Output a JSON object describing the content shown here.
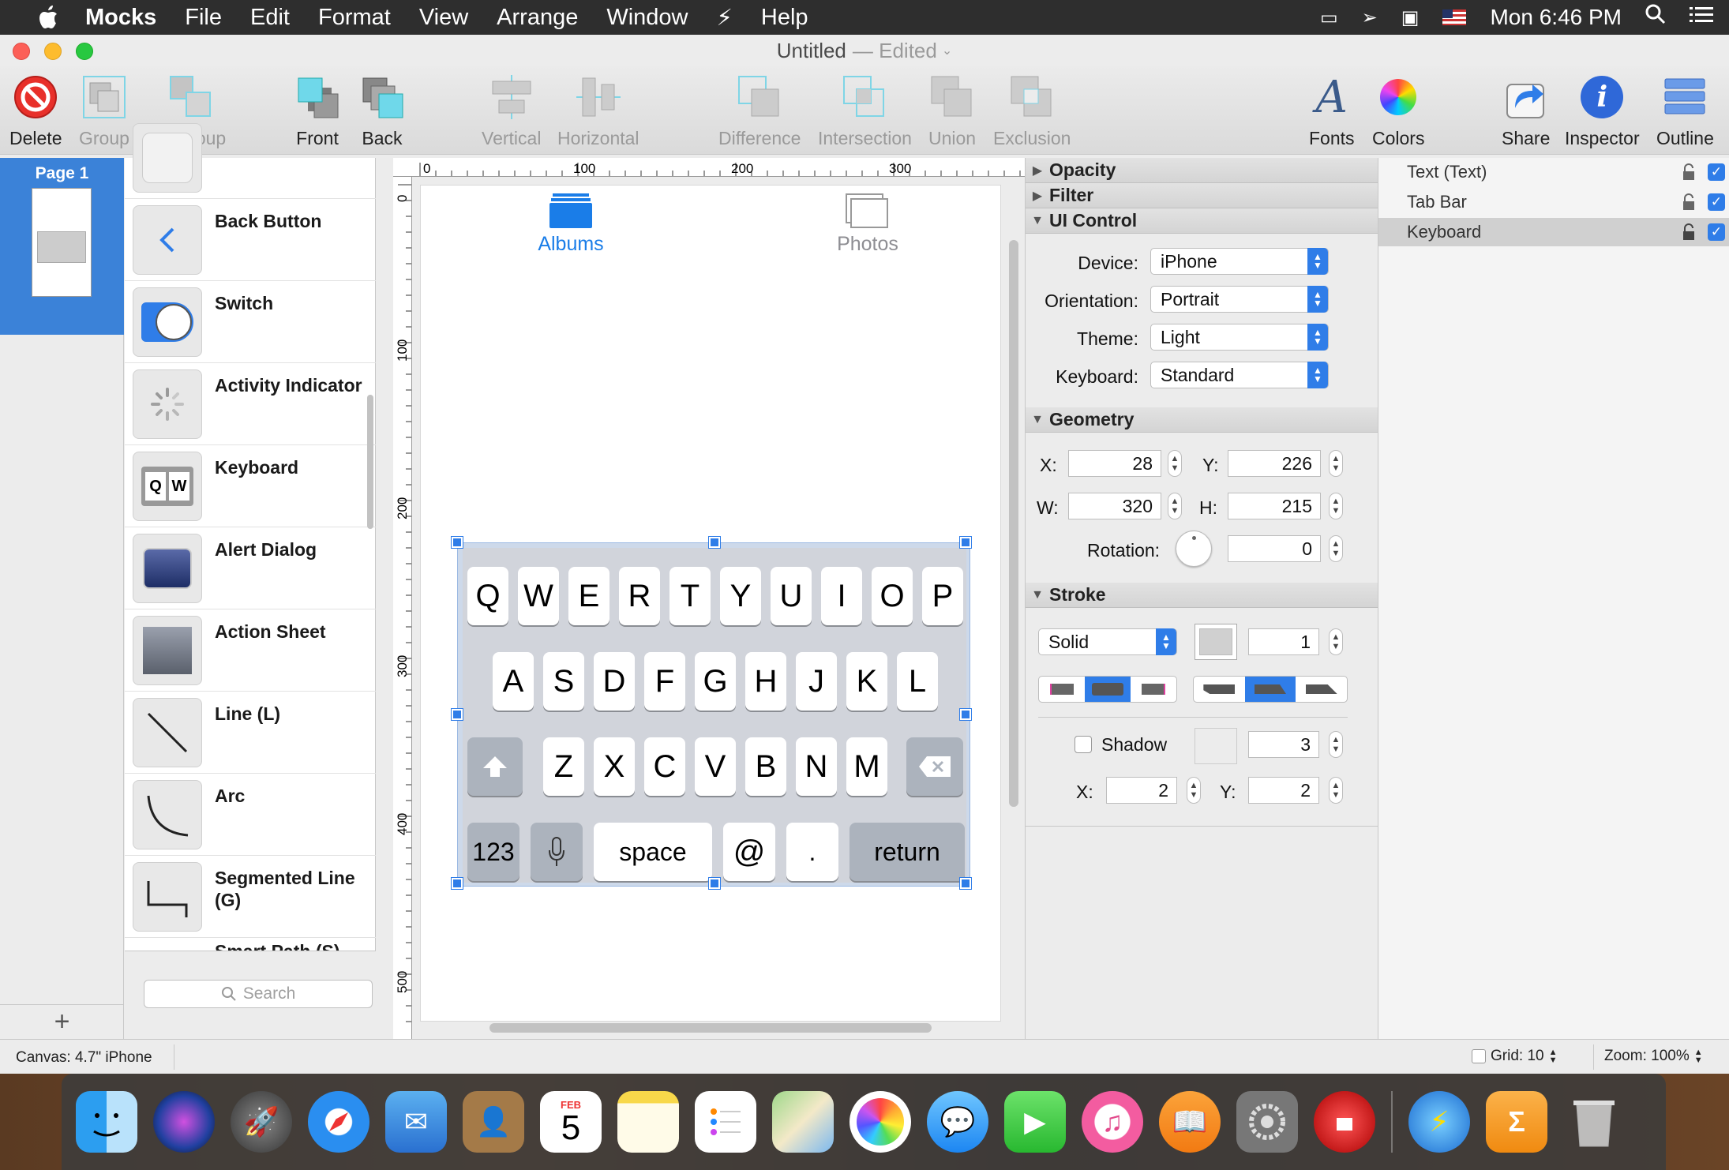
{
  "menubar": {
    "app_name": "Mocks",
    "items": [
      "File",
      "Edit",
      "Format",
      "View",
      "Arrange",
      "Window",
      "Help"
    ],
    "clock": "Mon 6:46 PM"
  },
  "window": {
    "title": "Untitled",
    "title_status": "— Edited"
  },
  "toolbar": {
    "delete": "Delete",
    "group": "Group",
    "ungroup": "Ungroup",
    "front": "Front",
    "back": "Back",
    "vertical": "Vertical",
    "horizontal": "Horizontal",
    "difference": "Difference",
    "intersection": "Intersection",
    "union": "Union",
    "exclusion": "Exclusion",
    "fonts": "Fonts",
    "colors": "Colors",
    "share": "Share",
    "inspector": "Inspector",
    "outline": "Outline"
  },
  "pages": {
    "current": "Page 1",
    "add": "+"
  },
  "library": {
    "items": [
      "Back Button",
      "Switch",
      "Activity Indicator",
      "Keyboard",
      "Alert Dialog",
      "Action Sheet",
      "Line (L)",
      "Arc",
      "Segmented Line (G)",
      "Smart Path (S)"
    ],
    "search_placeholder": "Search"
  },
  "canvas": {
    "ruler_h": [
      "0",
      "100",
      "200",
      "300"
    ],
    "ruler_v": [
      "0",
      "100",
      "200",
      "300",
      "400",
      "500"
    ],
    "tab_albums": "Albums",
    "tab_photos": "Photos",
    "keyboard": {
      "row1": [
        "Q",
        "W",
        "E",
        "R",
        "T",
        "Y",
        "U",
        "I",
        "O",
        "P"
      ],
      "row2": [
        "A",
        "S",
        "D",
        "F",
        "G",
        "H",
        "J",
        "K",
        "L"
      ],
      "row3": [
        "Z",
        "X",
        "C",
        "V",
        "B",
        "N",
        "M"
      ],
      "num": "123",
      "space": "space",
      "at": "@",
      "dot": ".",
      "return": "return"
    }
  },
  "inspector": {
    "opacity": "Opacity",
    "filter": "Filter",
    "ui_control": "UI Control",
    "device_label": "Device:",
    "device": "iPhone",
    "orientation_label": "Orientation:",
    "orientation": "Portrait",
    "theme_label": "Theme:",
    "theme": "Light",
    "keyboard_label": "Keyboard:",
    "keyboard": "Standard",
    "geometry": "Geometry",
    "x_label": "X:",
    "x": "28",
    "y_label": "Y:",
    "y": "226",
    "w_label": "W:",
    "w": "320",
    "h_label": "H:",
    "h": "215",
    "rotation_label": "Rotation:",
    "rotation": "0",
    "stroke": "Stroke",
    "stroke_style": "Solid",
    "stroke_width": "1",
    "shadow_label": "Shadow",
    "shadow_blur": "3",
    "shadow_x_label": "X:",
    "shadow_x": "2",
    "shadow_y_label": "Y:",
    "shadow_y": "2"
  },
  "outline": {
    "items": [
      "Text (Text)",
      "Tab Bar",
      "Keyboard"
    ],
    "selected": "Keyboard"
  },
  "status": {
    "canvas": "Canvas: 4.7\" iPhone",
    "grid": "Grid: 10",
    "zoom": "Zoom: 100%"
  },
  "dock": {
    "calendar_month": "FEB",
    "calendar_day": "5"
  },
  "colors": {
    "accent": "#2f7de8",
    "tab_active": "#1a7de8",
    "selection_bg": "#cdd9ea"
  }
}
